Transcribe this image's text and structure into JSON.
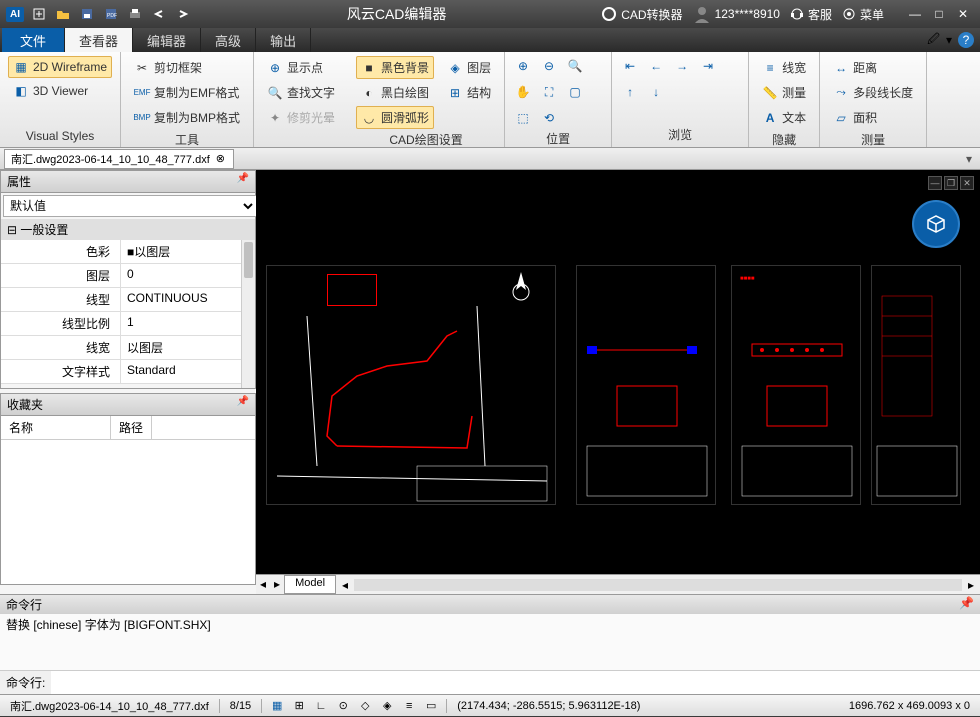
{
  "app": {
    "title": "风云CAD编辑器",
    "logo": "AI"
  },
  "titlebar_right": {
    "converter": "CAD转换器",
    "user": "123****8910",
    "support": "客服",
    "menu": "菜单"
  },
  "menu": {
    "file": "文件",
    "viewer": "查看器",
    "editor": "编辑器",
    "advanced": "高级",
    "output": "输出"
  },
  "ribbon": {
    "visual_styles": {
      "wireframe": "2D Wireframe",
      "viewer3d": "3D Viewer",
      "label": "Visual Styles"
    },
    "tools": {
      "clip_frame": "剪切框架",
      "copy_emf": "复制为EMF格式",
      "copy_bmp": "复制为BMP格式",
      "label": "工具"
    },
    "display": {
      "show_point": "显示点",
      "find_text": "查找文字",
      "trim_halo": "修剪光晕"
    },
    "cad_settings": {
      "black_bg": "黑色背景",
      "bw_draw": "黑白绘图",
      "smooth_arc": "圆滑弧形",
      "layer": "图层",
      "structure": "结构",
      "label": "CAD绘图设置"
    },
    "position": {
      "label": "位置"
    },
    "browse": {
      "label": "浏览"
    },
    "hide": {
      "linewidth": "线宽",
      "measure": "测量",
      "text": "文本",
      "label": "隐藏"
    },
    "measure": {
      "distance": "距离",
      "polyline_len": "多段线长度",
      "area": "面积",
      "label": "测量"
    }
  },
  "doc_tab": {
    "name": "南汇.dwg2023-06-14_10_10_48_777.dxf"
  },
  "properties": {
    "title": "属性",
    "default": "默认值",
    "section": "一般设置",
    "rows": [
      {
        "k": "色彩",
        "v": "■以图层"
      },
      {
        "k": "图层",
        "v": "0"
      },
      {
        "k": "线型",
        "v": "CONTINUOUS"
      },
      {
        "k": "线型比例",
        "v": "1"
      },
      {
        "k": "线宽",
        "v": "以图层"
      },
      {
        "k": "文字样式",
        "v": "Standard"
      }
    ]
  },
  "favorites": {
    "title": "收藏夹",
    "col_name": "名称",
    "col_path": "路径"
  },
  "model_tab": "Model",
  "command": {
    "title": "命令行",
    "history": "替换 [chinese] 字体为 [BIGFONT.SHX]",
    "label": "命令行:"
  },
  "statusbar": {
    "file": "南汇.dwg2023-06-14_10_10_48_777.dxf",
    "page": "8/15",
    "coords": "(2174.434; -286.5515; 5.963112E-18)",
    "size": "1696.762 x 469.0093 x 0"
  }
}
